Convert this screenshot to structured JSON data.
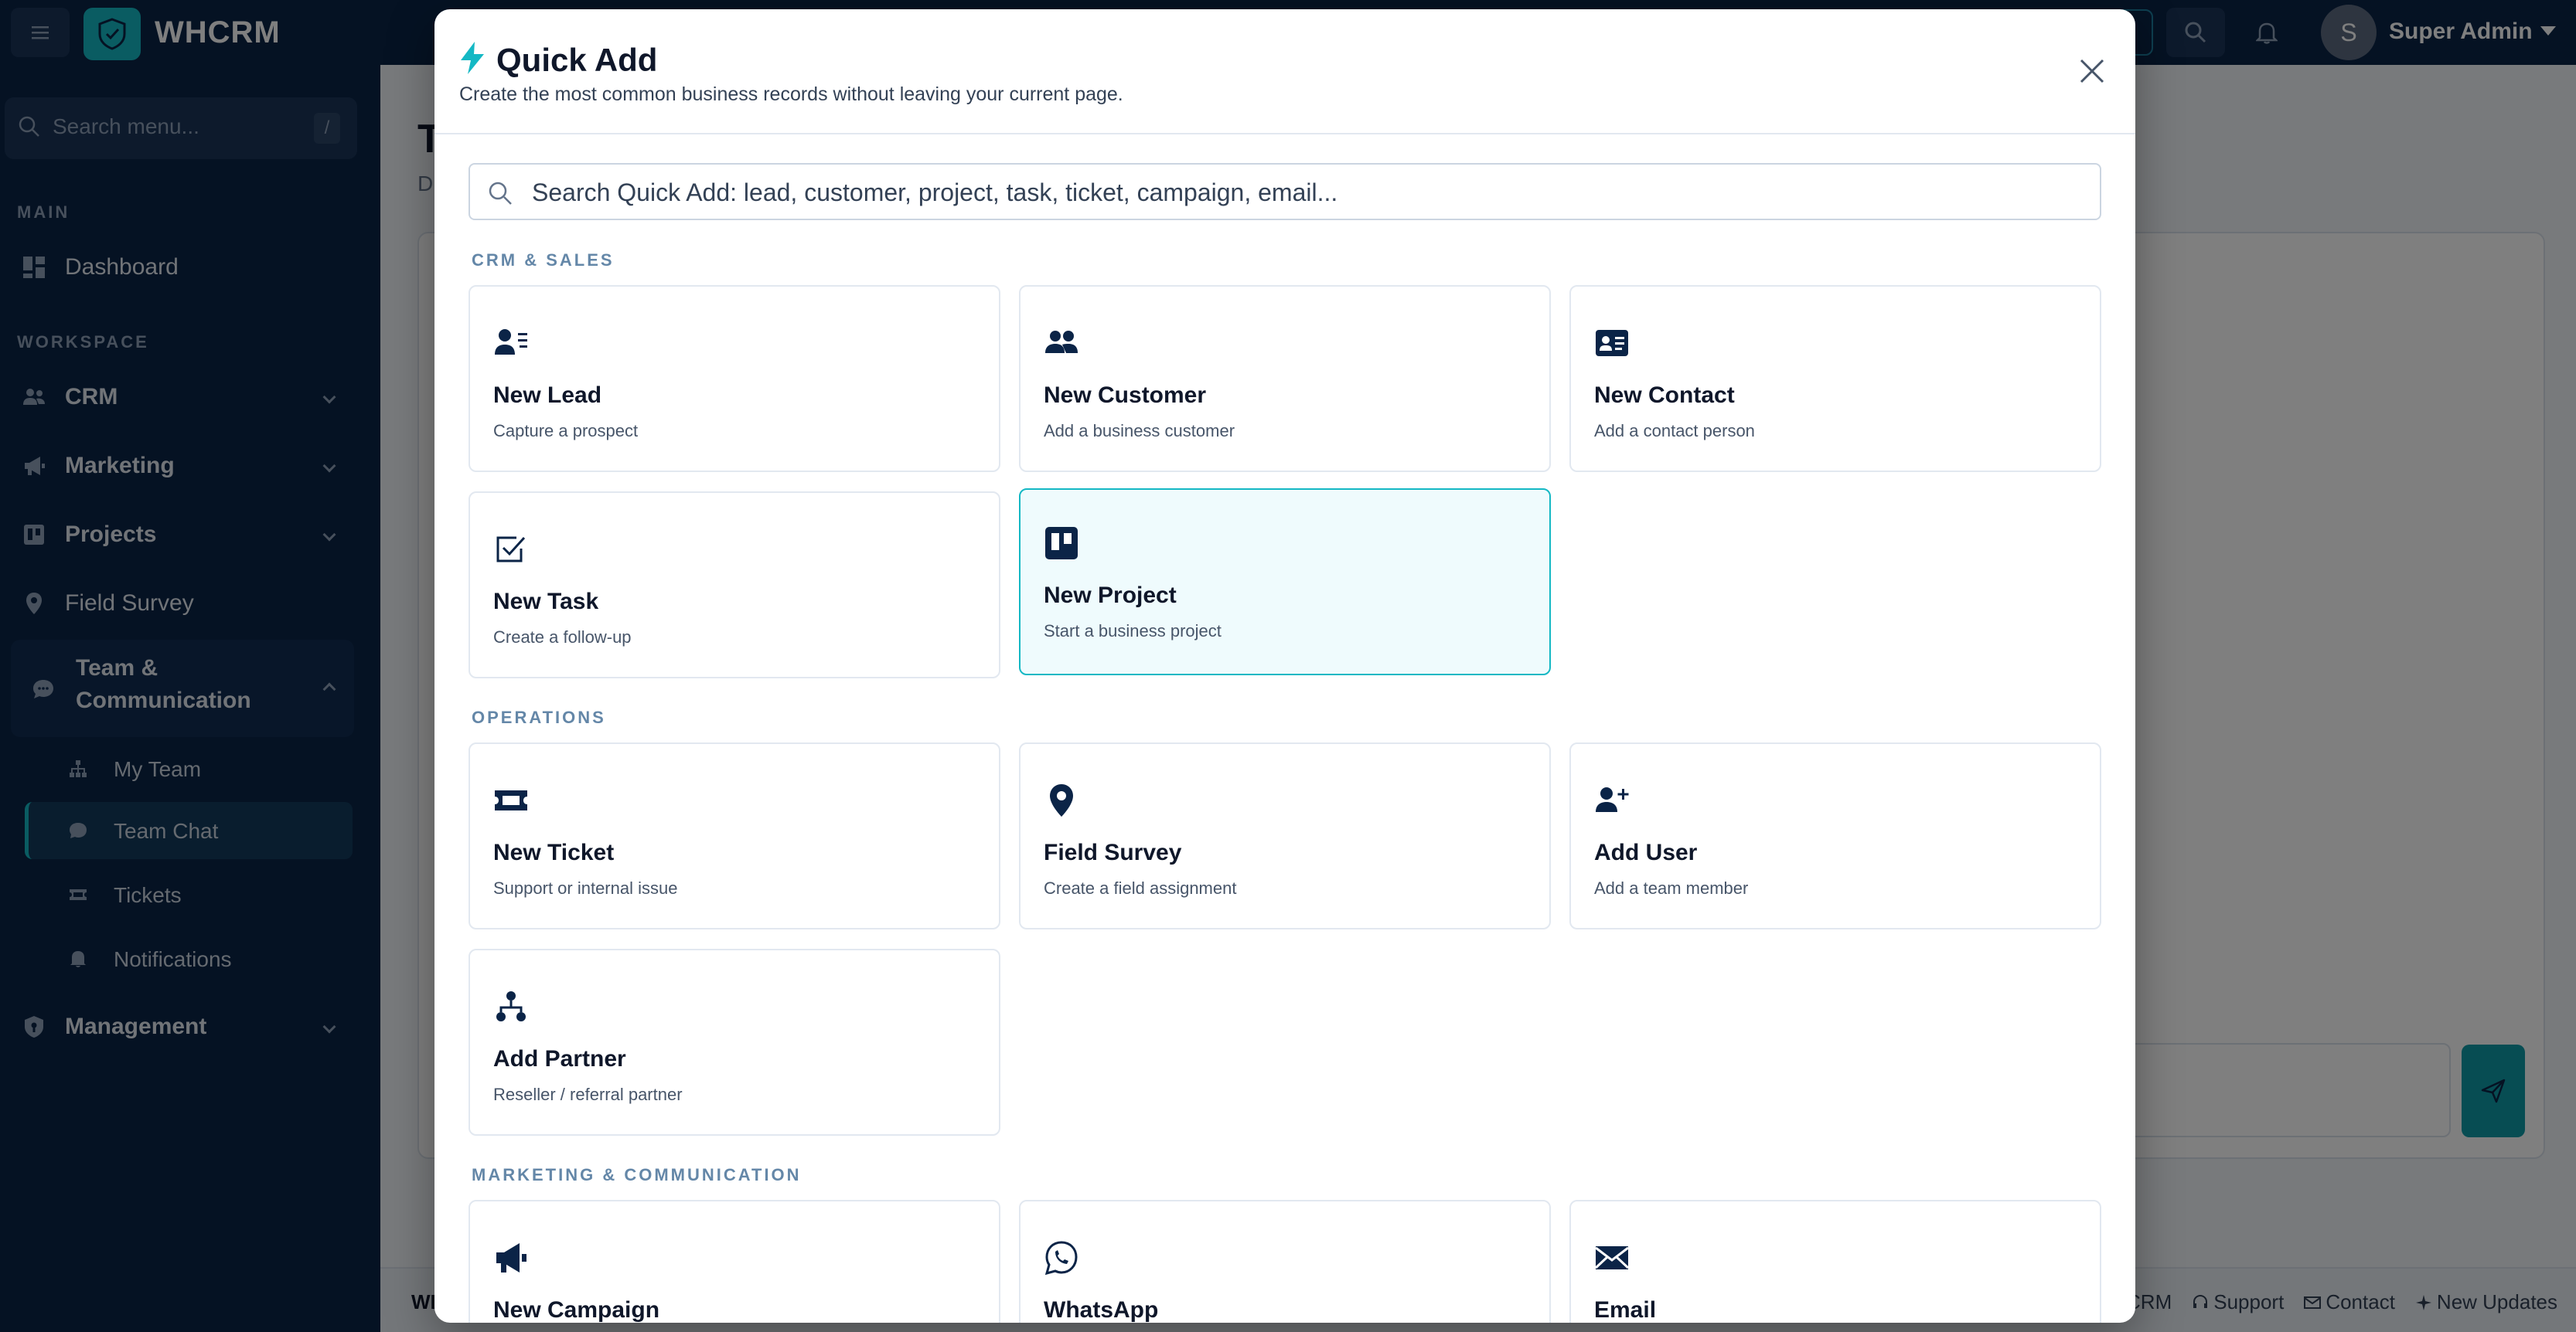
{
  "topbar": {
    "brand": "WHCRM",
    "avatar_initial": "S",
    "user_name": "Super Admin"
  },
  "sidebar": {
    "search_placeholder": "Search menu...",
    "search_shortcut": "/",
    "section_main": "MAIN",
    "section_workspace": "WORKSPACE",
    "items": {
      "dashboard": "Dashboard",
      "crm": "CRM",
      "marketing": "Marketing",
      "projects": "Projects",
      "field_survey": "Field Survey",
      "team_line1": "Team &",
      "team_line2": "Communication",
      "management": "Management"
    },
    "sub_items": {
      "my_team": "My Team",
      "team_chat": "Team Chat",
      "tickets": "Tickets",
      "notifications": "Notifications"
    }
  },
  "main": {
    "title_initial": "T",
    "subtitle_initial": "D"
  },
  "footer": {
    "brand_initial": "WI",
    "links": {
      "crm": "CRM",
      "support": "Support",
      "contact": "Contact",
      "updates": "New Updates"
    }
  },
  "modal": {
    "title": "Quick Add",
    "subtitle": "Create the most common business records without leaving your current page.",
    "search_placeholder": "Search Quick Add: lead, customer, project, task, ticket, campaign, email...",
    "sections": {
      "crm": "CRM & SALES",
      "ops": "OPERATIONS",
      "marketing": "MARKETING & COMMUNICATION"
    },
    "cards": {
      "lead": {
        "title": "New Lead",
        "desc": "Capture a prospect"
      },
      "customer": {
        "title": "New Customer",
        "desc": "Add a business customer"
      },
      "contact": {
        "title": "New Contact",
        "desc": "Add a contact person"
      },
      "task": {
        "title": "New Task",
        "desc": "Create a follow-up"
      },
      "project": {
        "title": "New Project",
        "desc": "Start a business project"
      },
      "ticket": {
        "title": "New Ticket",
        "desc": "Support or internal issue"
      },
      "survey": {
        "title": "Field Survey",
        "desc": "Create a field assignment"
      },
      "user": {
        "title": "Add User",
        "desc": "Add a team member"
      },
      "partner": {
        "title": "Add Partner",
        "desc": "Reseller / referral partner"
      },
      "campaign": {
        "title": "New Campaign",
        "desc": ""
      },
      "whatsapp": {
        "title": "WhatsApp",
        "desc": ""
      },
      "email": {
        "title": "Email",
        "desc": ""
      }
    }
  },
  "colors": {
    "navy": "#0b2447",
    "accent": "#14b8c4",
    "icon": "#0b2447"
  }
}
